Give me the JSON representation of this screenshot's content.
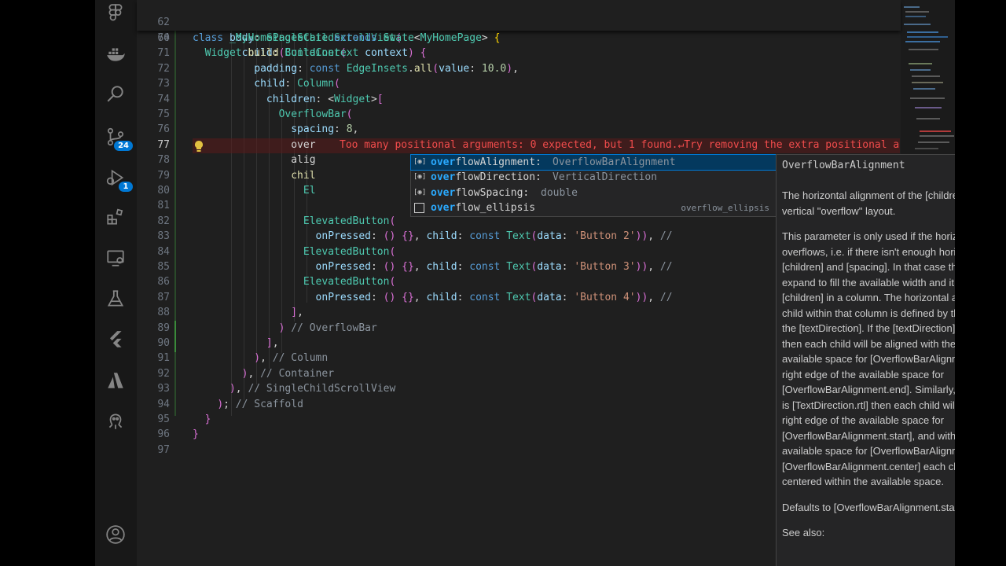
{
  "activity_bar": {
    "badges": {
      "source_control": "24",
      "run_debug": "1"
    }
  },
  "editor": {
    "sticky": [
      {
        "ln": "62",
        "code": "class _MyHomePageState extends State<MyHomePage> {"
      },
      {
        "ln": "64",
        "code": "  Widget build(BuildContext context) {"
      }
    ],
    "lines": [
      {
        "ln": "70",
        "code": "      body: SingleChildScrollView("
      },
      {
        "ln": "71",
        "code": "        child: Container("
      },
      {
        "ln": "72",
        "code": "          padding: const EdgeInsets.all(value: 10.0),"
      },
      {
        "ln": "73",
        "code": "          child: Column("
      },
      {
        "ln": "74",
        "code": "            children: <Widget>["
      },
      {
        "ln": "75",
        "code": "              OverflowBar("
      },
      {
        "ln": "76",
        "code": "                spacing: 8,"
      },
      {
        "ln": "77",
        "code": "                over"
      },
      {
        "ln": "78",
        "code": "                alig"
      },
      {
        "ln": "79",
        "code": "                chil"
      },
      {
        "ln": "80",
        "code": "                  El"
      },
      {
        "ln": "81",
        "code": ""
      },
      {
        "ln": "82",
        "code": "                  ElevatedButton("
      },
      {
        "ln": "83",
        "code": "                    onPressed: () {}, child: const Text(data: 'Button 2')), //"
      },
      {
        "ln": "84",
        "code": "                  ElevatedButton("
      },
      {
        "ln": "85",
        "code": "                    onPressed: () {}, child: const Text(data: 'Button 3')), //"
      },
      {
        "ln": "86",
        "code": "                  ElevatedButton("
      },
      {
        "ln": "87",
        "code": "                    onPressed: () {}, child: const Text(data: 'Button 4')), //"
      },
      {
        "ln": "88",
        "code": "                ],"
      },
      {
        "ln": "89",
        "code": "              ) // OverflowBar"
      },
      {
        "ln": "90",
        "code": "            ],"
      },
      {
        "ln": "91",
        "code": "          ), // Column"
      },
      {
        "ln": "92",
        "code": "        ), // Container"
      },
      {
        "ln": "93",
        "code": "      ), // SingleChildScrollView"
      },
      {
        "ln": "94",
        "code": "    ); // Scaffold"
      },
      {
        "ln": "95",
        "code": "  }"
      },
      {
        "ln": "96",
        "code": "}"
      },
      {
        "ln": "97",
        "code": ""
      }
    ],
    "error_message": "Too many positional arguments: 0 expected, but 1 found.↵Try removing the extra positional a"
  },
  "suggest": {
    "items": [
      {
        "match": "over",
        "rest": "flowAlignment:",
        "detail": "OverflowBarAlignment",
        "right": ""
      },
      {
        "match": "over",
        "rest": "flowDirection:",
        "detail": "VerticalDirection",
        "right": ""
      },
      {
        "match": "over",
        "rest": "flowSpacing:",
        "detail": "double",
        "right": ""
      },
      {
        "match": "over",
        "rest": "flow_ellipsis",
        "detail": "",
        "right": "overflow_ellipsis"
      }
    ]
  },
  "docs": {
    "title": "OverflowBarAlignment",
    "close": "×",
    "paragraphs": [
      "The horizontal alignment of the [children] within the vertical \"overflow\" layout.",
      "This parameter is only used if the horizontal layout overflows, i.e. if there isn't enough horizontal room for the [children] and [spacing]. In that case the overflow bar will expand to fill the available width and it will layout its [children] in a column. The horizontal alignment of each child within that column is defined by this parameter and the [textDirection]. If the [textDirection] is [TextDirection.ltr] then each child will be aligned with the left edge of the available space for [OverflowBarAlignment.start], with the right edge of the available space for [OverflowBarAlignment.end]. Similarly, if the [textDirection] is [TextDirection.rtl] then each child will be aligned with the right edge of the available space for [OverflowBarAlignment.start], and with the left edge of the available space for [OverflowBarAlignment.end]. For [OverflowBarAlignment.center] each child is horizontally centered within the available space.",
      "Defaults to [OverflowBarAlignment.start].",
      "See also:"
    ]
  },
  "colors": {
    "accent": "#0078d4",
    "error": "#f14c4c",
    "selection": "#04395e"
  }
}
